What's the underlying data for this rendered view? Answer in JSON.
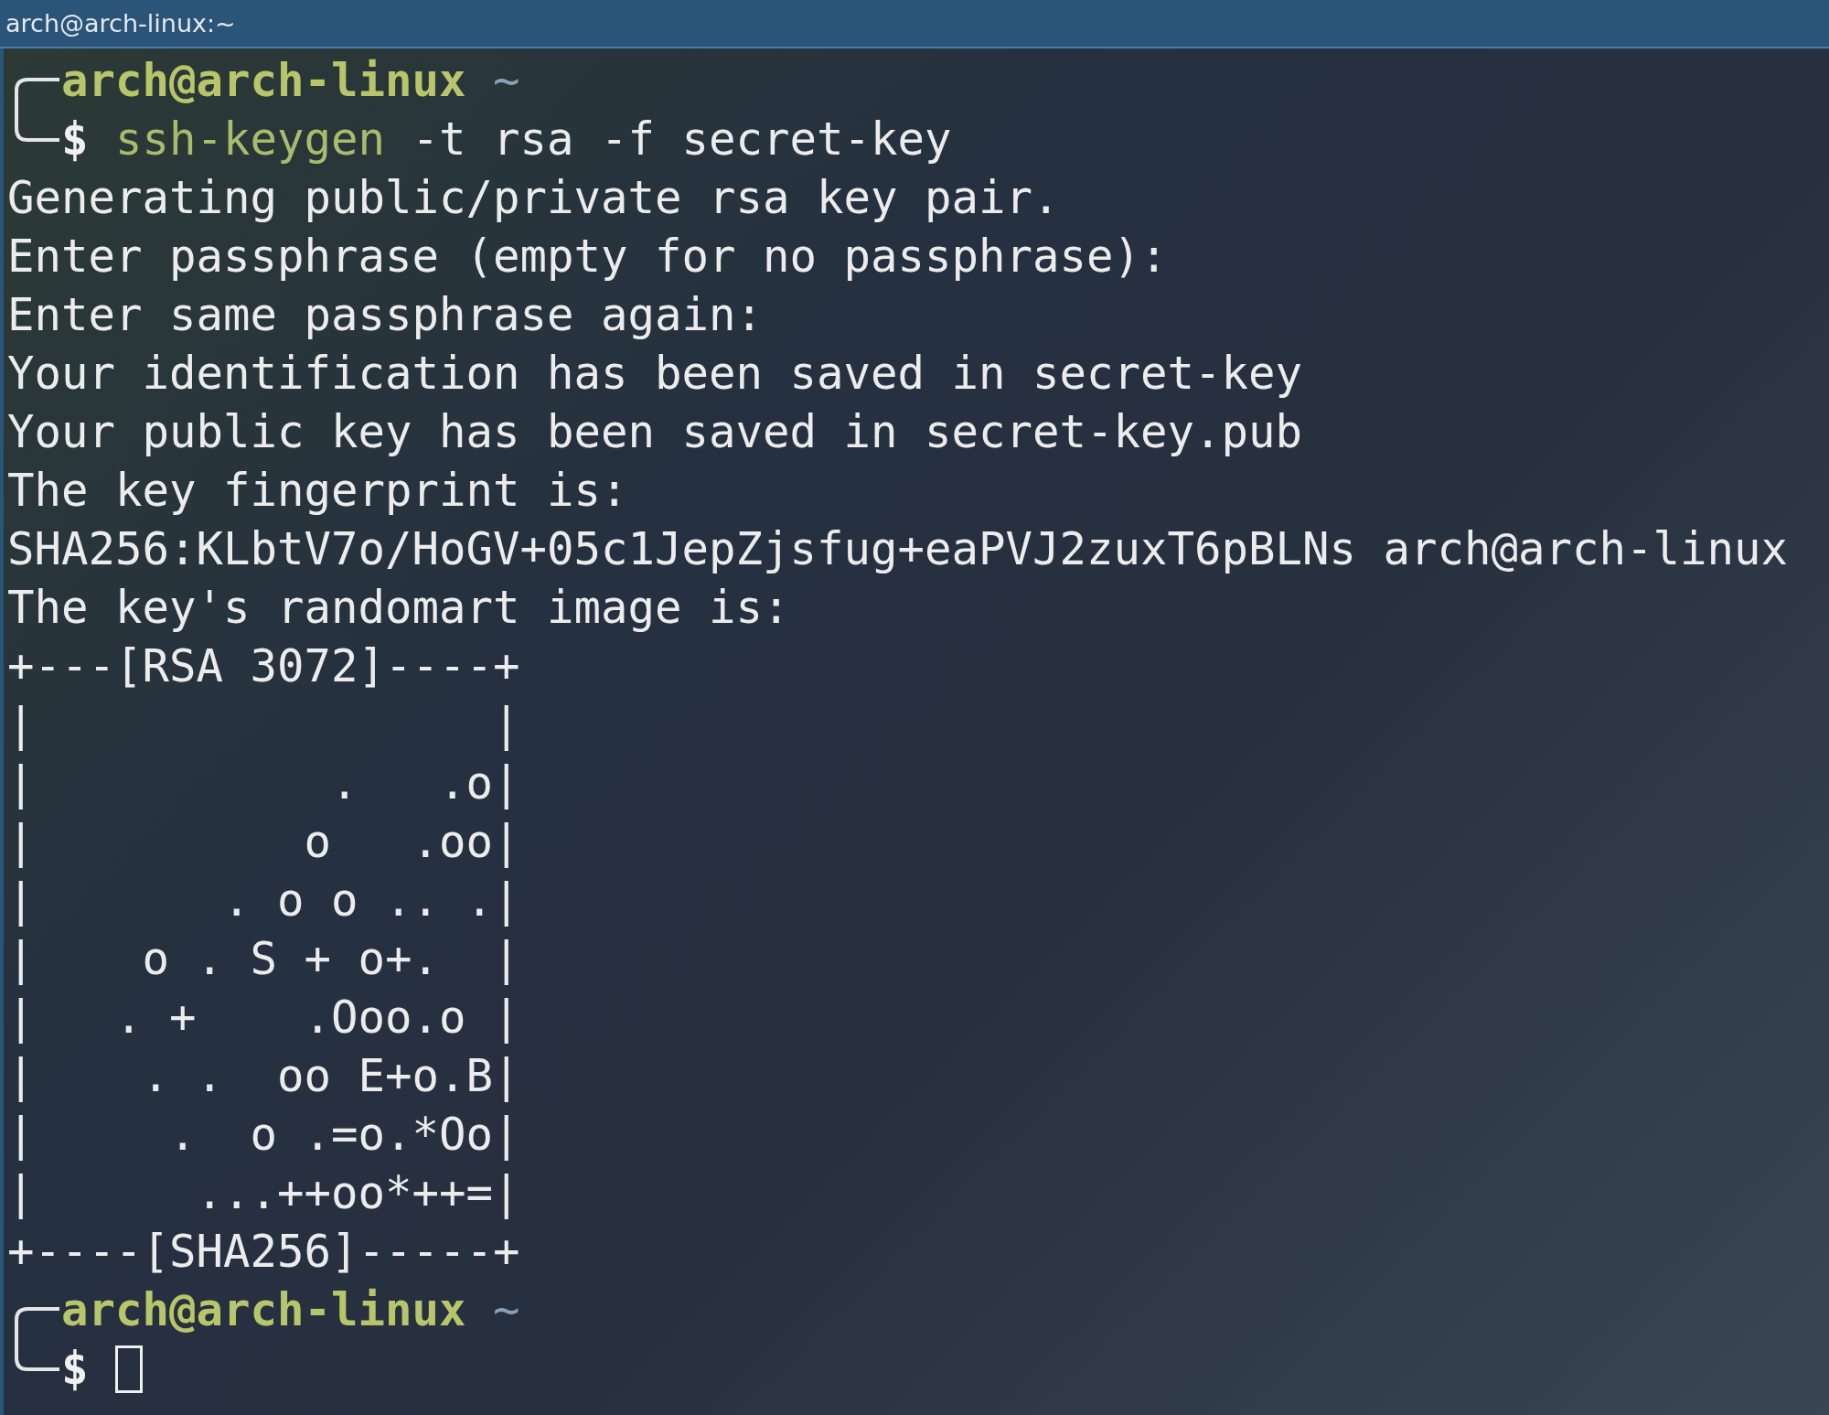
{
  "window": {
    "title": "arch@arch-linux:~"
  },
  "lines": [
    {
      "kind": "prompt",
      "user": "arch@arch-linux",
      "dir": "~",
      "symbol": "$",
      "command": "ssh-keygen",
      "args": "-t rsa -f secret-key",
      "cursor": false
    },
    {
      "kind": "output",
      "text": "Generating public/private rsa key pair."
    },
    {
      "kind": "output",
      "text": "Enter passphrase (empty for no passphrase):"
    },
    {
      "kind": "output",
      "text": "Enter same passphrase again:"
    },
    {
      "kind": "output",
      "text": "Your identification has been saved in secret-key"
    },
    {
      "kind": "output",
      "text": "Your public key has been saved in secret-key.pub"
    },
    {
      "kind": "output",
      "text": "The key fingerprint is:"
    },
    {
      "kind": "output",
      "text": "SHA256:KLbtV7o/HoGV+05c1JepZjsfug+eaPVJ2zuxT6pBLNs arch@arch-linux"
    },
    {
      "kind": "output",
      "text": "The key's randomart image is:"
    },
    {
      "kind": "art",
      "text": "+---[RSA 3072]----+"
    },
    {
      "kind": "art",
      "text": "|                 |"
    },
    {
      "kind": "art",
      "text": "|           .   .o|"
    },
    {
      "kind": "art",
      "text": "|          o   .oo|"
    },
    {
      "kind": "art",
      "text": "|       . o o .. .|"
    },
    {
      "kind": "art",
      "text": "|    o . S + o+.  |"
    },
    {
      "kind": "art",
      "text": "|   . +    .Ooo.o |"
    },
    {
      "kind": "art",
      "text": "|    . .  oo E+o.B|"
    },
    {
      "kind": "art",
      "text": "|     .  o .=o.*Oo|"
    },
    {
      "kind": "art",
      "text": "|      ...++oo*++=|"
    },
    {
      "kind": "art",
      "text": "+----[SHA256]-----+"
    },
    {
      "kind": "prompt",
      "user": "arch@arch-linux",
      "dir": "~",
      "symbol": "$",
      "cursor": true
    }
  ]
}
